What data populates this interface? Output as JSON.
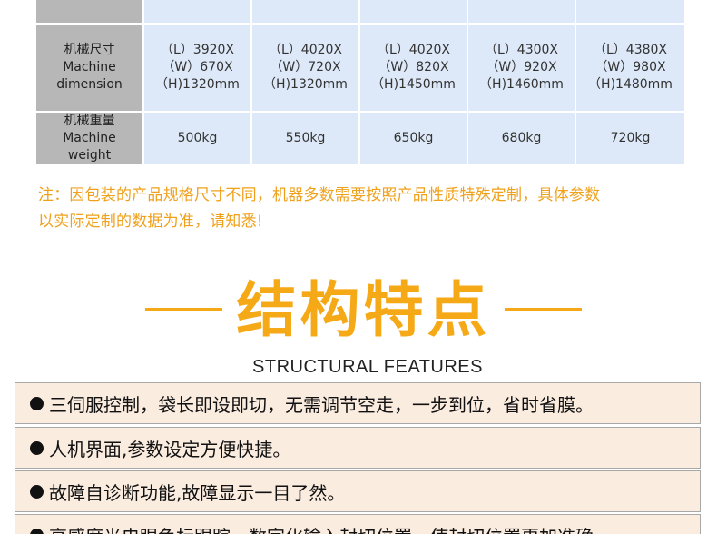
{
  "spec_table": {
    "rows": [
      {
        "header": [],
        "values": [
          [],
          [],
          [],
          [],
          []
        ]
      },
      {
        "header": [
          "机械尺寸",
          "Machine",
          "dimension"
        ],
        "values": [
          [
            "（L）3920X",
            "（W）670X",
            "（H)1320mm"
          ],
          [
            "（L）4020X",
            "（W）720X",
            "（H)1320mm"
          ],
          [
            "（L）4020X",
            "（W）820X",
            "（H)1450mm"
          ],
          [
            "（L）4300X",
            "（W）920X",
            "（H)1460mm"
          ],
          [
            "（L）4380X",
            "（W）980X",
            "（H)1480mm"
          ]
        ]
      },
      {
        "header": [
          "机械重量",
          "Machine",
          "weight"
        ],
        "values": [
          [
            "500kg"
          ],
          [
            "550kg"
          ],
          [
            "650kg"
          ],
          [
            "680kg"
          ],
          [
            "720kg"
          ]
        ]
      }
    ]
  },
  "note": {
    "lines": [
      "注：因包装的产品规格尺寸不同，机器多数需要按照产品性质特殊定制，具体参数",
      "以实际定制的数据为准，请知悉!"
    ],
    "color": "#f0a11c"
  },
  "section": {
    "title": "结构特点",
    "subtitle": "STRUCTURAL FEATURES",
    "accent_color": "#f6a917"
  },
  "features": [
    {
      "text": "三伺服控制，袋长即设即切，无需调节空走，一步到位，省时省膜。"
    },
    {
      "text": "人机界面,参数设定方便快捷。"
    },
    {
      "text": "故障自诊断功能,故障显示一目了然。"
    },
    {
      "text": "高感度光电眼色标跟踪，数字化输入封切位置，使封切位置更加准确。"
    }
  ]
}
